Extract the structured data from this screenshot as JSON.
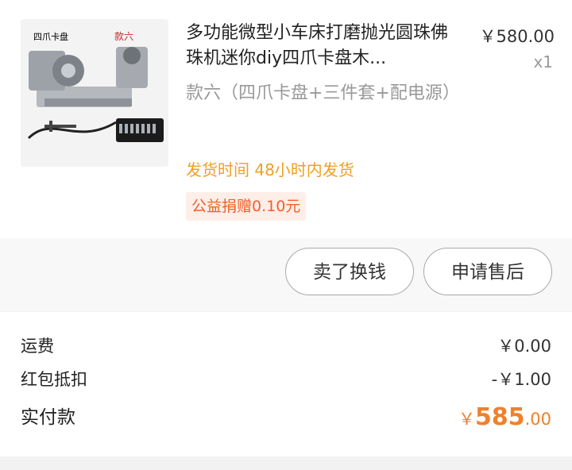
{
  "product": {
    "image_labels": [
      "四爪卡盘",
      "款六"
    ],
    "title": "多功能微型小车床打磨抛光圆珠佛珠机迷你diy四爪卡盘木...",
    "price": "￥580.00",
    "quantity": "x1",
    "spec": "款六（四爪卡盘+三件套+配电源）",
    "shipping_label": "发货时间",
    "shipping_value": "48小时内发货",
    "charity": "公益捐赠0.10元"
  },
  "actions": {
    "sell": "卖了换钱",
    "after_sale": "申请售后"
  },
  "summary": {
    "freight_label": "运费",
    "freight_value": "￥0.00",
    "coupon_label": "红包抵扣",
    "coupon_value": "-￥1.00",
    "paid_label": "实付款",
    "paid_currency": "￥",
    "paid_int": "585",
    "paid_dec": ".00"
  },
  "colors": {
    "accent_orange": "#f0802c",
    "shipping_yellow": "#f0a020",
    "charity_bg": "#fdeee8"
  }
}
